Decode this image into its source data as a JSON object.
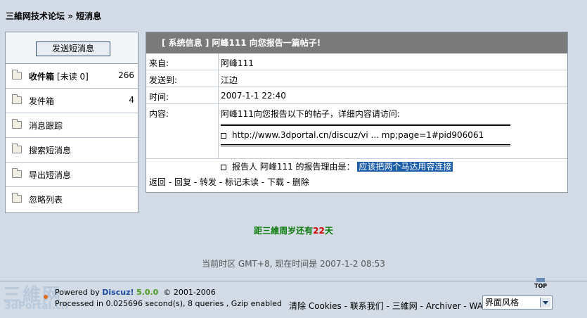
{
  "breadcrumb": {
    "forum": "三維网技术论坛",
    "separator": " » ",
    "current": "短消息"
  },
  "sidebar": {
    "send_button": "发送短消息",
    "items": [
      {
        "label": "收件箱",
        "sub": "[未读 0]",
        "count": "266"
      },
      {
        "label": "发件箱",
        "count": "4"
      },
      {
        "label": "消息跟踪"
      },
      {
        "label": "搜索短消息"
      },
      {
        "label": "导出短消息"
      },
      {
        "label": "忽略列表"
      }
    ]
  },
  "message": {
    "title": "[ 系统信息 ] 阿峰111 向您报告一篇帖子!",
    "from_label": "来自:",
    "from": "阿峰111",
    "to_label": "发送到:",
    "to": "江边",
    "time_label": "时间:",
    "time": "2007-1-1 22:40",
    "content_label": "内容:",
    "content_intro": "阿峰111向您报告以下的帖子，详细内容请访问:",
    "content_link": "http://www.3dportal.cn/discuz/vi ... mp;page=1#pid906061",
    "content_reason_prefix": "报告人 阿峰111 的报告理由是：",
    "content_reason": "应该把两个马达用容连接",
    "actions": {
      "back": "返回",
      "reply": "回复",
      "forward": "转发",
      "mark_unread": "标记未读",
      "download": "下载",
      "delete": "删除",
      "sep": " - "
    }
  },
  "countdown": {
    "prefix": "距三維周岁还有",
    "days": "22",
    "suffix": "天"
  },
  "timezone": "当前时区 GMT+8, 现在时间是 2007-1-2 08:53",
  "footer": {
    "logo_big": "三維网",
    "logo_small": "3dPortal.cn",
    "powered_prefix": "Powered by ",
    "brand": "Discuz!",
    "version": "5.0.0",
    "copyright": "© 2001-2006",
    "processed": "Processed in 0.025696 second(s), 8 queries , Gzip enabled",
    "top": "TOP",
    "links": {
      "clear_cookies": "清除 Cookies",
      "contact": "联系我们",
      "site": "三維网",
      "archiver": "Archiver",
      "wap": "WAP",
      "sep": " - "
    },
    "style_select": "界面风格"
  },
  "colors": {
    "background": "#d3dce6",
    "header_bar": "#7a7a7a",
    "highlight": "#1d5ea8",
    "countdown": "#0a7a0a",
    "countdown_num": "#d20000"
  }
}
